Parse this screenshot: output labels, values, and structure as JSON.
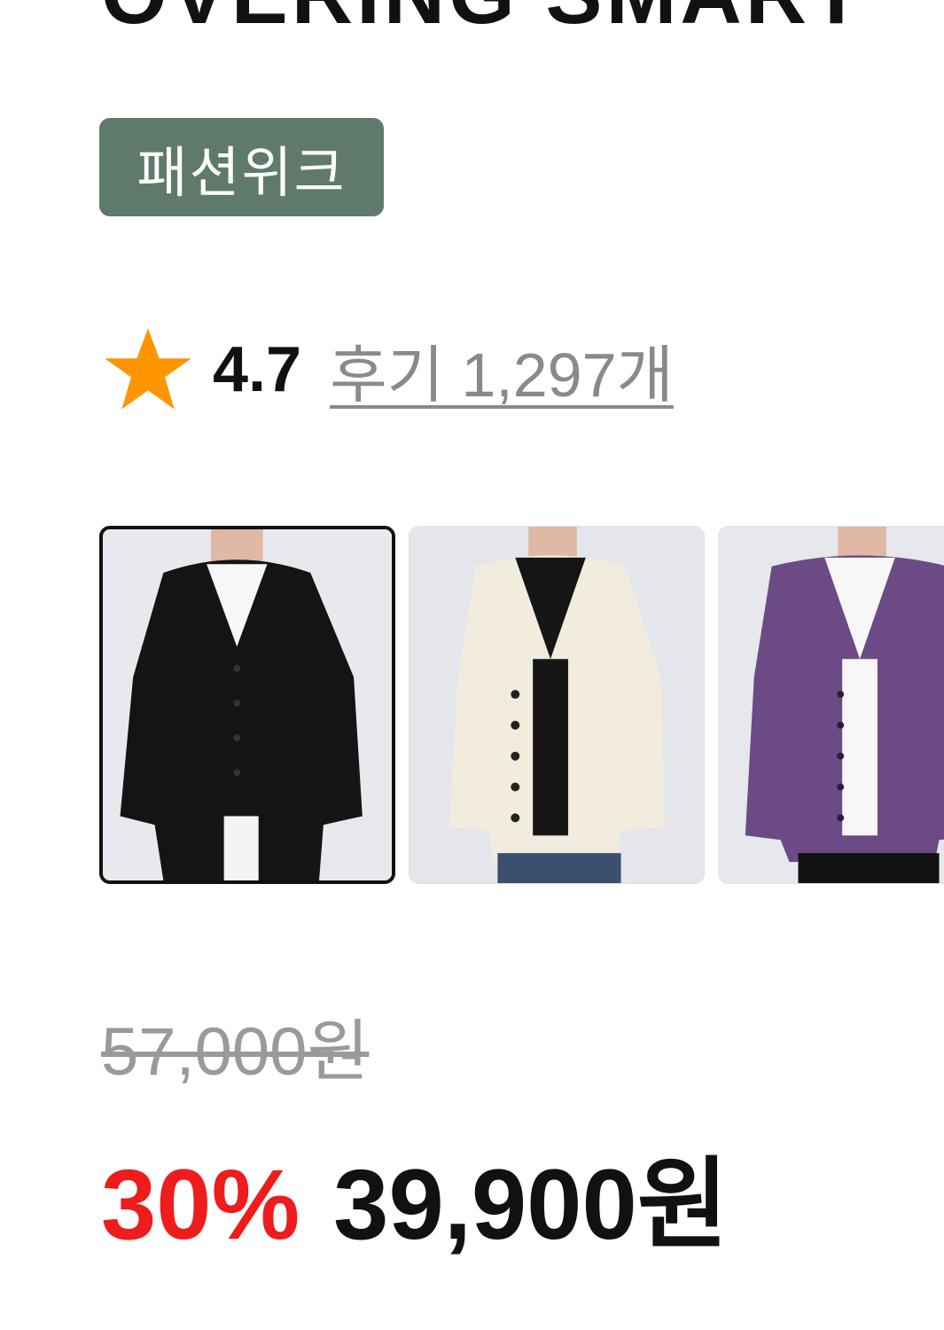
{
  "product": {
    "title": "OVERING SMART",
    "badge": "패션위크",
    "rating": "4.7",
    "reviews_label": "후기 1,297개"
  },
  "thumbnails": [
    {
      "color_name": "black",
      "selected": true
    },
    {
      "color_name": "ivory",
      "selected": false
    },
    {
      "color_name": "purple",
      "selected": false
    }
  ],
  "pricing": {
    "original_price": "57,000원",
    "discount_rate": "30%",
    "sale_price": "39,900원"
  },
  "colors": {
    "badge_bg": "#5f7a6a",
    "star": "#ff9500",
    "discount": "#ee1c1c",
    "muted_text": "#9a9a9a"
  },
  "icons": {
    "rating": "star-icon"
  }
}
